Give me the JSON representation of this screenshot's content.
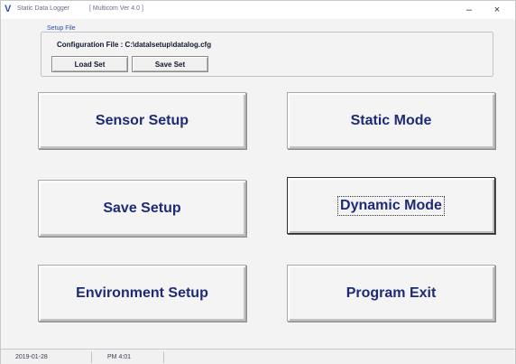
{
  "window": {
    "icon": "V",
    "title": "Static Data Logger",
    "version": "[ Multicom  Ver 4.0 ]",
    "minimize": "–",
    "close": "×"
  },
  "setup_file": {
    "legend": "Setup File",
    "config_label": "Configuration File :  C:\\datalsetup\\datalog.cfg",
    "load_label": "Load Set",
    "save_label": "Save Set"
  },
  "buttons": {
    "sensor_setup": "Sensor Setup",
    "static_mode": "Static Mode",
    "save_setup": "Save Setup",
    "dynamic_mode": "Dynamic Mode",
    "environment_setup": "Environment Setup",
    "program_exit": "Program Exit"
  },
  "status": {
    "date": "2019-01-28",
    "time": "PM 4:01"
  }
}
